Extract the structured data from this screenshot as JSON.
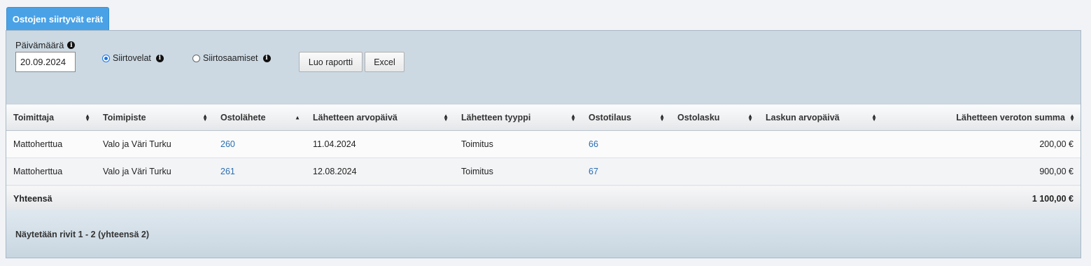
{
  "tab": {
    "label": "Ostojen siirtyvät erät"
  },
  "filters": {
    "date_label": "Päivämäärä",
    "date_value": "20.09.2024",
    "radio_options": [
      {
        "label": "Siirtovelat",
        "checked": true
      },
      {
        "label": "Siirtosaamiset",
        "checked": false
      }
    ],
    "create_report_label": "Luo raportti",
    "excel_label": "Excel"
  },
  "table": {
    "columns": [
      "Toimittaja",
      "Toimipiste",
      "Ostolähete",
      "Lähetteen arvopäivä",
      "Lähetteen tyyppi",
      "Ostotilaus",
      "Ostolasku",
      "Laskun arvopäivä",
      "Lähetteen veroton summa"
    ],
    "rows": [
      {
        "supplier": "Mattoherttua",
        "location": "Valo ja Väri Turku",
        "dispatch": "260",
        "dispatch_date": "11.04.2024",
        "type": "Toimitus",
        "order": "66",
        "invoice": "",
        "invoice_date": "",
        "amount": "200,00 €"
      },
      {
        "supplier": "Mattoherttua",
        "location": "Valo ja Väri Turku",
        "dispatch": "261",
        "dispatch_date": "12.08.2024",
        "type": "Toimitus",
        "order": "67",
        "invoice": "",
        "invoice_date": "",
        "amount": "900,00 €"
      }
    ],
    "total_label": "Yhteensä",
    "total_amount": "1 100,00 €"
  },
  "footer": {
    "text": "Näytetään rivit 1 - 2 (yhteensä 2)"
  },
  "colors": {
    "accent": "#4aa2e6",
    "link": "#2a6eb0",
    "panel": "#ccd9e3"
  }
}
